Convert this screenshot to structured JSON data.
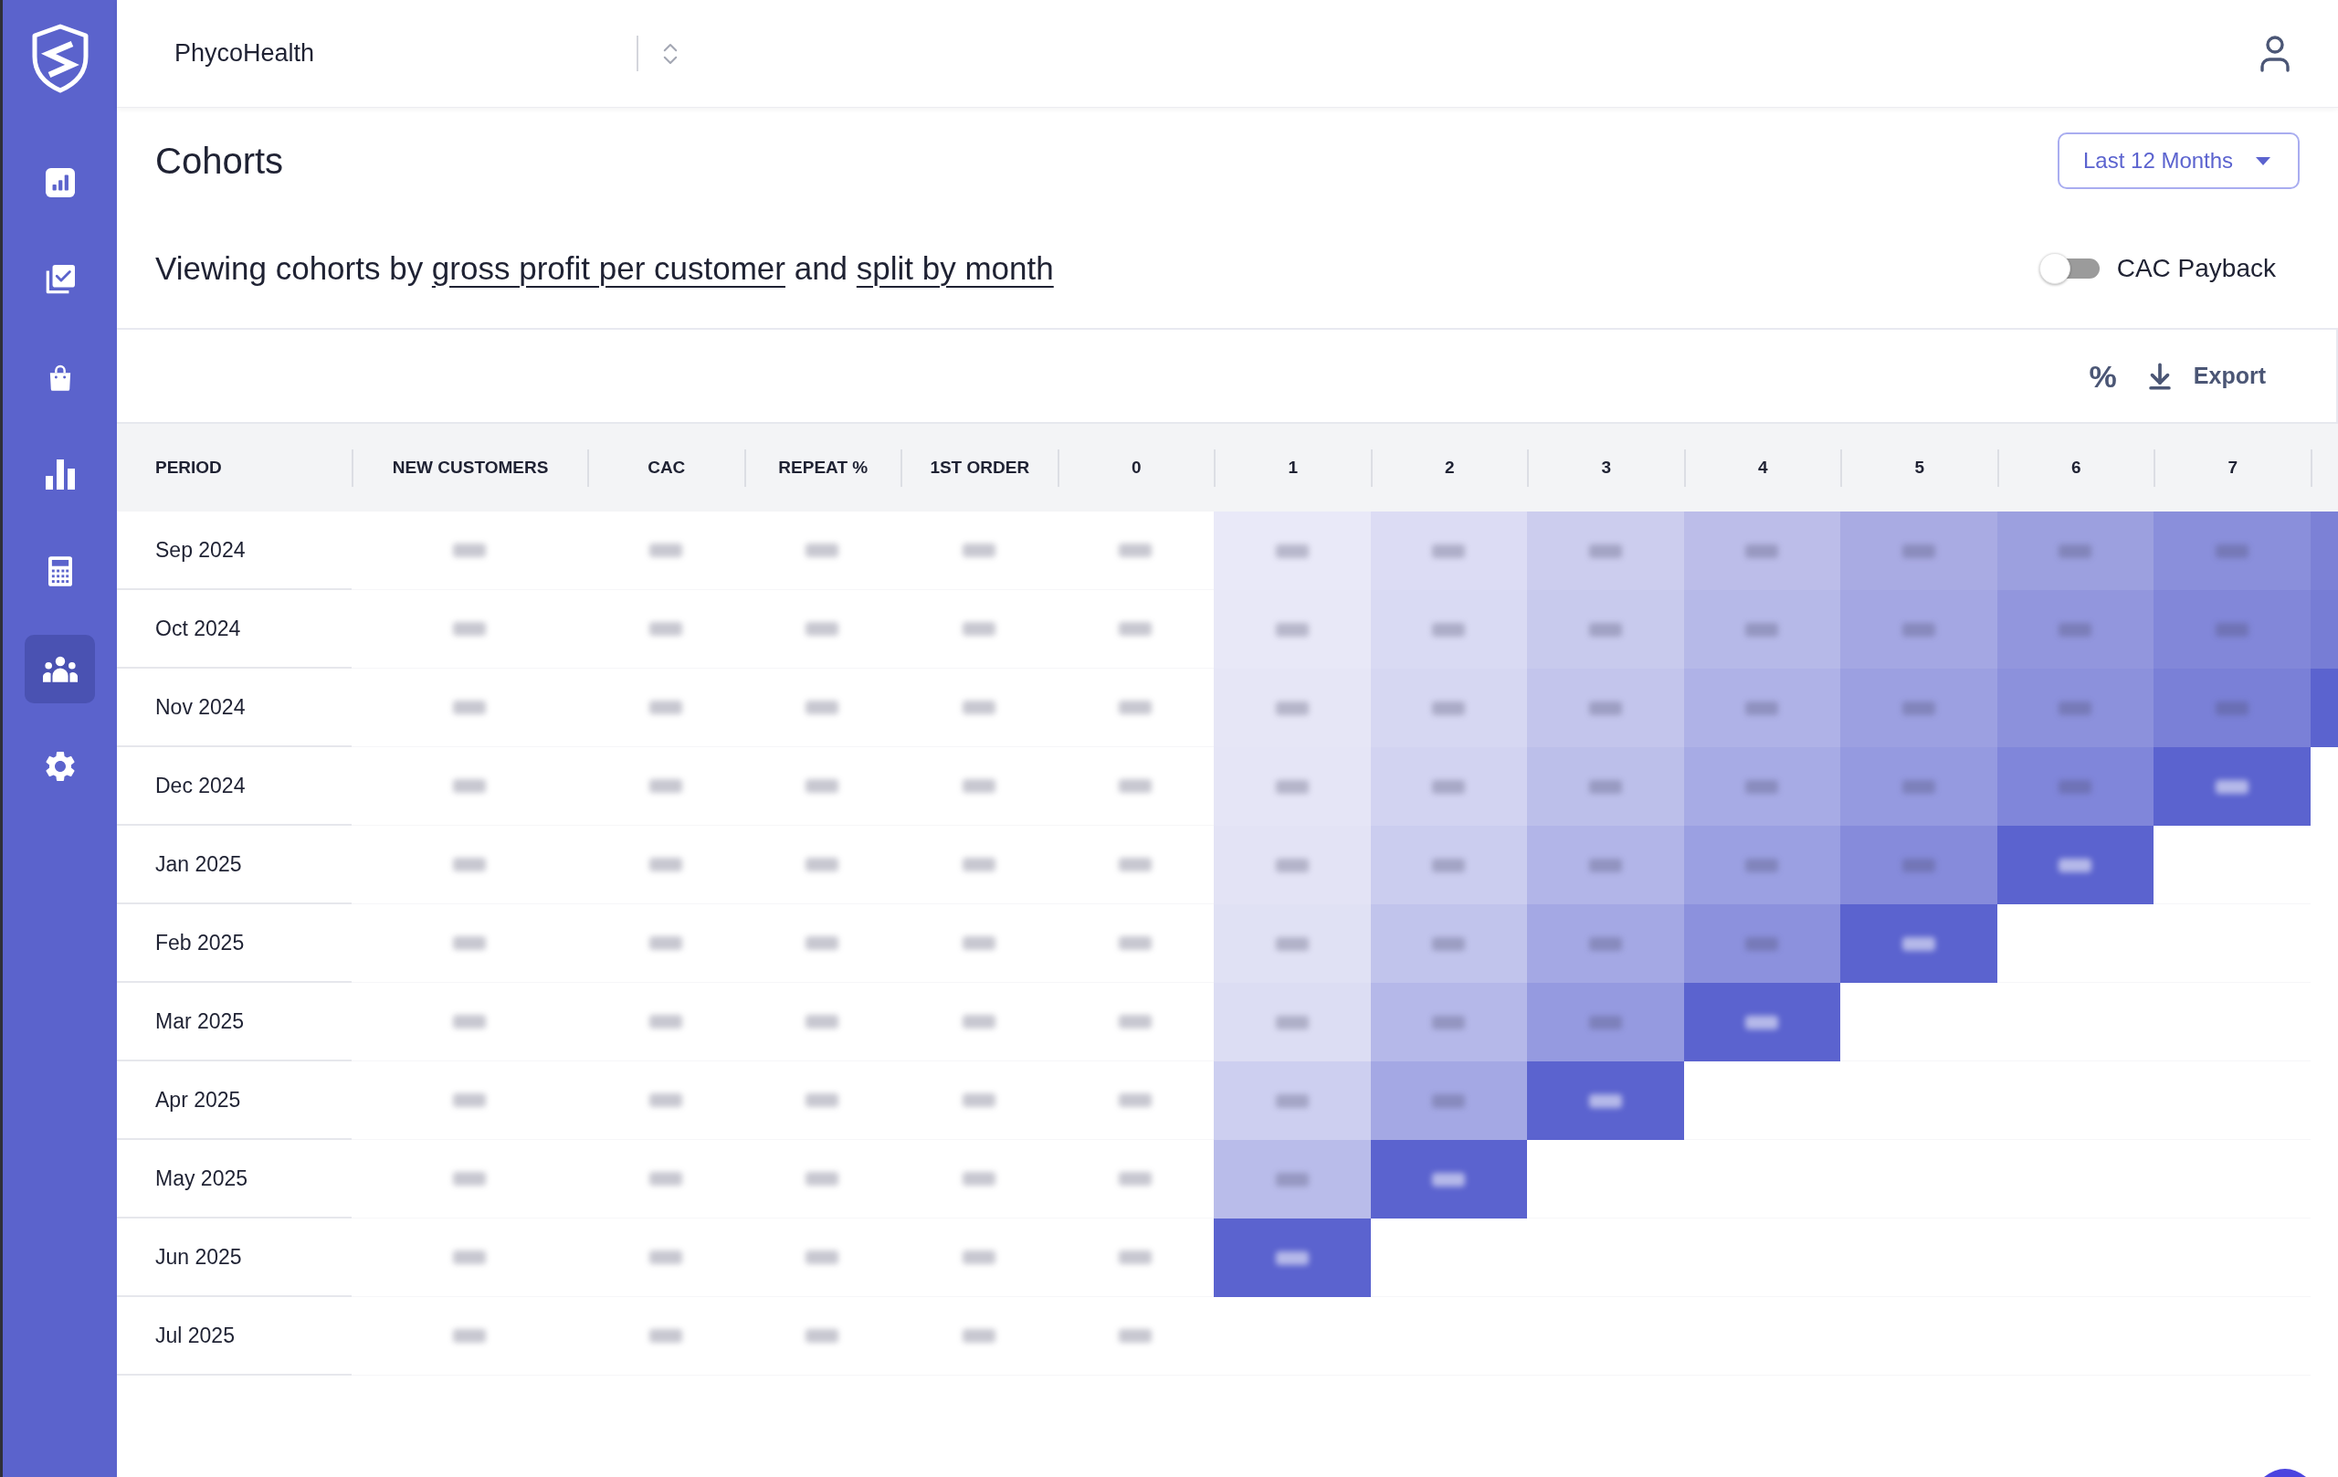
{
  "sidebar": {
    "items": [
      {
        "selected": false
      },
      {
        "selected": false
      },
      {
        "selected": false
      },
      {
        "selected": false
      },
      {
        "selected": false
      },
      {
        "selected": true
      },
      {
        "selected": false
      }
    ]
  },
  "top_bar": {
    "workspace": "PhycoHealth"
  },
  "page": {
    "title": "Cohorts",
    "date_range": "Last 12 Months"
  },
  "summary": {
    "parts": [
      {
        "kind": "text",
        "text": "Viewing cohorts by "
      },
      {
        "kind": "link",
        "text": "gross profit per customer"
      },
      {
        "kind": "text",
        "text": " and "
      },
      {
        "kind": "link",
        "text": "split by month"
      }
    ]
  },
  "cac_payback": {
    "label": "CAC Payback",
    "on": false
  },
  "toolbar": {
    "percent": "%",
    "export": "Export"
  },
  "table": {
    "values_blurred": true,
    "columns": [
      {
        "label": "PERIOD",
        "kind": "period"
      },
      {
        "label": "NEW CUSTOMERS",
        "kind": "metric"
      },
      {
        "label": "CAC",
        "kind": "metric"
      },
      {
        "label": "REPEAT %",
        "kind": "metric"
      },
      {
        "label": "1ST ORDER",
        "kind": "metric"
      },
      {
        "label": "0",
        "kind": "metric"
      },
      {
        "label": "1",
        "kind": "cohort"
      },
      {
        "label": "2",
        "kind": "cohort"
      },
      {
        "label": "3",
        "kind": "cohort"
      },
      {
        "label": "4",
        "kind": "cohort"
      },
      {
        "label": "5",
        "kind": "cohort"
      },
      {
        "label": "6",
        "kind": "cohort"
      },
      {
        "label": "7",
        "kind": "cohort"
      }
    ],
    "rows": [
      {
        "period": "Sep 2024",
        "cells": [
          {
            "color": "#e9e9f8"
          },
          {
            "color": "#dcdcf4"
          },
          {
            "color": "#cccdee"
          },
          {
            "color": "#bcbde9"
          },
          {
            "color": "#a9abe3"
          },
          {
            "color": "#9ca0df"
          },
          {
            "color": "#8a8fdb"
          },
          {
            "color": "#7c81d6"
          }
        ]
      },
      {
        "period": "Oct 2024",
        "cells": [
          {
            "color": "#e8e8f7"
          },
          {
            "color": "#d9daf3"
          },
          {
            "color": "#c8caed"
          },
          {
            "color": "#b6b9e8"
          },
          {
            "color": "#a4a7e3"
          },
          {
            "color": "#9296dd"
          },
          {
            "color": "#8287d9"
          },
          {
            "color": "#777dd5"
          }
        ]
      },
      {
        "period": "Nov 2024",
        "cells": [
          {
            "color": "#e6e6f6"
          },
          {
            "color": "#d6d7f2"
          },
          {
            "color": "#c3c5ec"
          },
          {
            "color": "#afb2e7"
          },
          {
            "color": "#9ca0e1"
          },
          {
            "color": "#8c91dc"
          },
          {
            "color": "#7a80d7"
          },
          {
            "color": "#5b63cf"
          }
        ]
      },
      {
        "period": "Dec 2024",
        "cells": [
          {
            "color": "#e5e5f6"
          },
          {
            "color": "#d2d3f1"
          },
          {
            "color": "#bcbfea"
          },
          {
            "color": "#a7abe5"
          },
          {
            "color": "#959ae0"
          },
          {
            "color": "#8086da"
          },
          {
            "color": "#5b63cf"
          }
        ]
      },
      {
        "period": "Jan 2025",
        "cells": [
          {
            "color": "#e3e3f5"
          },
          {
            "color": "#cbcdef"
          },
          {
            "color": "#b2b5e8"
          },
          {
            "color": "#9ba0e2"
          },
          {
            "color": "#868bdb"
          },
          {
            "color": "#5b63cf"
          }
        ]
      },
      {
        "period": "Feb 2025",
        "cells": [
          {
            "color": "#e0e1f4"
          },
          {
            "color": "#c1c4ec"
          },
          {
            "color": "#a4a8e4"
          },
          {
            "color": "#8c91dd"
          },
          {
            "color": "#5b63cf"
          }
        ]
      },
      {
        "period": "Mar 2025",
        "cells": [
          {
            "color": "#dcddf3"
          },
          {
            "color": "#b5b8e9"
          },
          {
            "color": "#959ae0"
          },
          {
            "color": "#5b63cf"
          }
        ]
      },
      {
        "period": "Apr 2025",
        "cells": [
          {
            "color": "#cdcff0"
          },
          {
            "color": "#a4a8e4"
          },
          {
            "color": "#5b63cf"
          }
        ]
      },
      {
        "period": "May 2025",
        "cells": [
          {
            "color": "#b9bcea"
          },
          {
            "color": "#5b63cf"
          }
        ]
      },
      {
        "period": "Jun 2025",
        "cells": [
          {
            "color": "#5b63cf"
          }
        ]
      },
      {
        "period": "Jul 2025",
        "cells": []
      }
    ]
  }
}
